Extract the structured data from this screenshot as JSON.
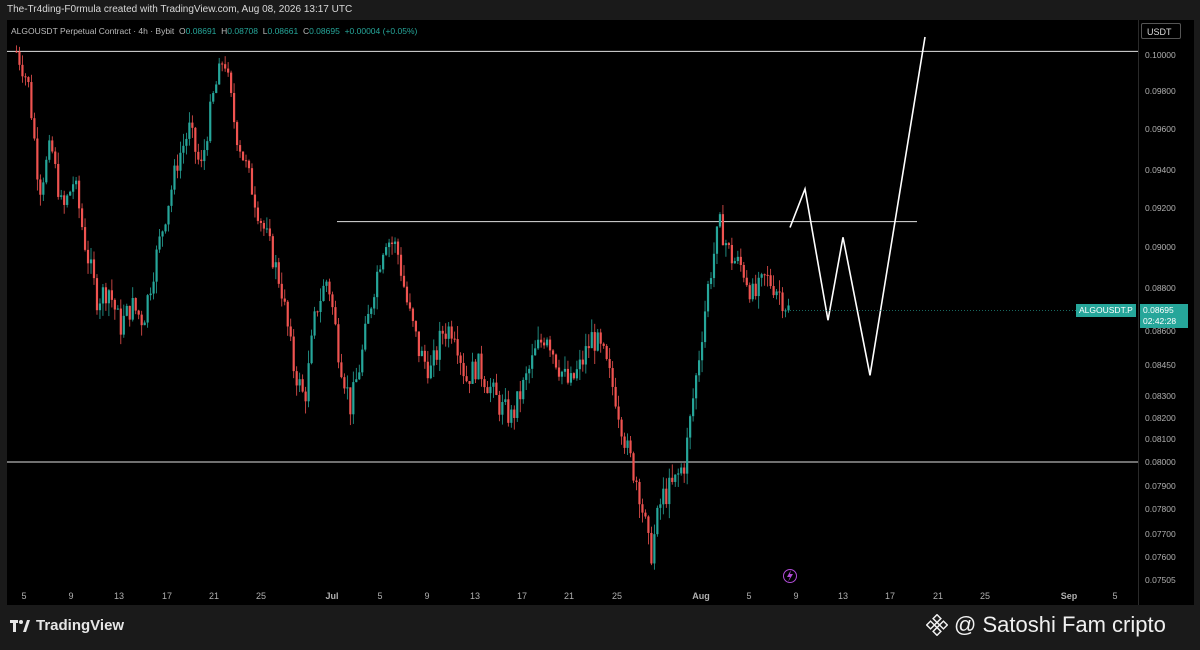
{
  "header": {
    "credit": "The-Tr4ding-F0rmula created with TradingView.com, Aug 08, 2026 13:17 UTC"
  },
  "legend": {
    "symbol": "ALGOUSDT Perpetual Contract · 4h · Bybit",
    "o_label": "O",
    "o_value": "0.08691",
    "h_label": "H",
    "h_value": "0.08708",
    "l_label": "L",
    "l_value": "0.08661",
    "c_label": "C",
    "c_value": "0.08695",
    "change": "+0.00004 (+0.05%)"
  },
  "axis": {
    "currency": "USDT"
  },
  "price_tag": {
    "symbol": "ALGOUSDT.P",
    "price": "0.08695",
    "countdown": "02:42:28"
  },
  "footer": {
    "brand": "TradingView",
    "watermark": "@ Satoshi Fam cripto"
  },
  "colors": {
    "up": "#26a69a",
    "down": "#ef5350",
    "background": "#000000",
    "lines": "#e0e0e0"
  },
  "chart_data": {
    "type": "candlestick",
    "timeframe": "4h",
    "y_ticks": [
      "0.10000",
      "0.09800",
      "0.09600",
      "0.09400",
      "0.09200",
      "0.09000",
      "0.08800",
      "0.08600",
      "0.08450",
      "0.08300",
      "0.08200",
      "0.08100",
      "0.08000",
      "0.07900",
      "0.07800",
      "0.07700",
      "0.07600",
      "0.07505"
    ],
    "x_ticks": [
      "5",
      "9",
      "13",
      "17",
      "21",
      "25",
      "Jul",
      "5",
      "9",
      "13",
      "17",
      "21",
      "25",
      "Aug",
      "5",
      "9",
      "13",
      "17",
      "21",
      "25",
      "Sep",
      "5"
    ],
    "horizontal_levels": [
      0.1002,
      0.0913,
      0.08
    ],
    "price_path": [
      [
        0,
        0.1002
      ],
      [
        2,
        0.0985
      ],
      [
        4,
        0.093
      ],
      [
        6,
        0.0952
      ],
      [
        8,
        0.0918
      ],
      [
        10,
        0.0935
      ],
      [
        12,
        0.09
      ],
      [
        14,
        0.0875
      ],
      [
        16,
        0.088
      ],
      [
        18,
        0.0862
      ],
      [
        20,
        0.0872
      ],
      [
        22,
        0.0865
      ],
      [
        25,
        0.0905
      ],
      [
        28,
        0.0945
      ],
      [
        30,
        0.096
      ],
      [
        32,
        0.094
      ],
      [
        34,
        0.0975
      ],
      [
        36,
        0.1
      ],
      [
        38,
        0.096
      ],
      [
        40,
        0.094
      ],
      [
        42,
        0.0918
      ],
      [
        44,
        0.09
      ],
      [
        46,
        0.088
      ],
      [
        48,
        0.0845
      ],
      [
        50,
        0.0828
      ],
      [
        52,
        0.087
      ],
      [
        54,
        0.0885
      ],
      [
        56,
        0.085
      ],
      [
        58,
        0.0825
      ],
      [
        60,
        0.085
      ],
      [
        62,
        0.088
      ],
      [
        64,
        0.0905
      ],
      [
        66,
        0.09
      ],
      [
        68,
        0.087
      ],
      [
        70,
        0.085
      ],
      [
        72,
        0.0842
      ],
      [
        74,
        0.086
      ],
      [
        76,
        0.0862
      ],
      [
        78,
        0.0838
      ],
      [
        80,
        0.0845
      ],
      [
        82,
        0.0835
      ],
      [
        84,
        0.0825
      ],
      [
        86,
        0.082
      ],
      [
        88,
        0.0835
      ],
      [
        90,
        0.085
      ],
      [
        92,
        0.086
      ],
      [
        94,
        0.0845
      ],
      [
        96,
        0.0835
      ],
      [
        98,
        0.0845
      ],
      [
        100,
        0.0858
      ],
      [
        102,
        0.0848
      ],
      [
        104,
        0.083
      ],
      [
        106,
        0.0805
      ],
      [
        108,
        0.079
      ],
      [
        110,
        0.076
      ],
      [
        112,
        0.0785
      ],
      [
        114,
        0.079
      ],
      [
        116,
        0.08
      ],
      [
        118,
        0.084
      ],
      [
        120,
        0.088
      ],
      [
        122,
        0.0912
      ],
      [
        124,
        0.0895
      ],
      [
        126,
        0.089
      ],
      [
        128,
        0.0875
      ],
      [
        130,
        0.0885
      ],
      [
        132,
        0.088
      ],
      [
        134,
        0.087
      ]
    ],
    "projection": [
      [
        790,
        0.091
      ],
      [
        805,
        0.093
      ],
      [
        828,
        0.0865
      ],
      [
        843,
        0.0905
      ],
      [
        870,
        0.084
      ],
      [
        925,
        0.101
      ]
    ]
  }
}
